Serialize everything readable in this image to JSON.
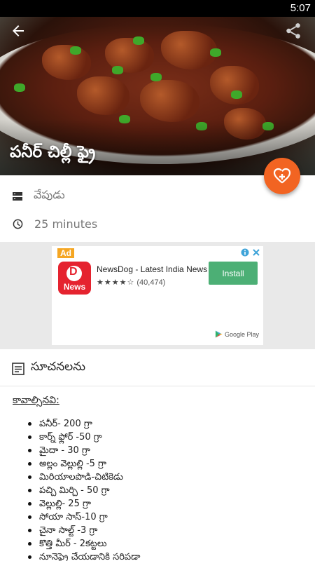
{
  "status_bar": {
    "time": "5:07"
  },
  "header": {
    "back_icon": "arrow-left-icon",
    "share_icon": "share-icon",
    "title": "పనీర్ చిల్లీ ఫ్రై"
  },
  "fab": {
    "icon": "heart-plus-icon",
    "color": "#f26422"
  },
  "info": {
    "category": "వేపుడు",
    "category_icon": "list-icon",
    "time": "25 minutes",
    "time_icon": "clock-icon"
  },
  "ad": {
    "badge": "Ad",
    "app_name": "NewsDog - Latest India News",
    "icon_letter": "D",
    "icon_text": "News",
    "stars": "★★★★☆",
    "rating_count": "(40,474)",
    "install_label": "Install",
    "store_label": "Google Play"
  },
  "instructions": {
    "title": "సూచనలను",
    "icon": "notes-icon",
    "ingredients_heading": "కావాల్సినవి:",
    "ingredients": [
      "పనీర్- 200 గ్రా",
      "కార్న్ ఫ్లోర్ -50 గ్రా",
      "మైదా - 30 గ్రా",
      "అల్లం వెల్లుల్లి -5 గ్రా",
      "మిరియాలపొడి-చిటికెడు",
      "పచ్చి మిర్చి - 50 గ్రా",
      "వెల్లుల్లి- 25 గ్రా",
      "సోయా సాస్-10 గ్రా",
      "చైనా సాల్ట్ -3 గ్రా",
      "కొత్తి మీర్ - 2కట్టలు",
      "నూనెఫ్రై చేయడానికి సరిపడా"
    ]
  }
}
